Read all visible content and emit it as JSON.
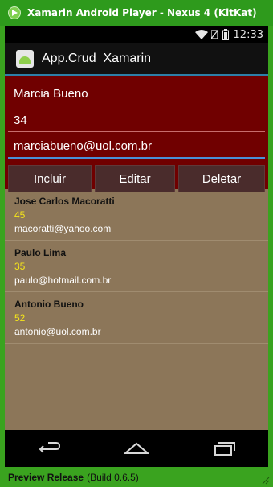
{
  "window": {
    "title": "Xamarin Android Player - Nexus 4 (KitKat)",
    "footer_bold": "Preview Release",
    "footer_text": "(Build 0.6.5)"
  },
  "status": {
    "time": "12:33"
  },
  "app": {
    "title": "App.Crud_Xamarin"
  },
  "form": {
    "name": "Marcia Bueno",
    "age": "34",
    "email": "marciabueno@uol.com.br"
  },
  "buttons": {
    "include": "Incluir",
    "edit": "Editar",
    "delete": "Deletar"
  },
  "list": [
    {
      "name": "Jose Carlos Macoratti",
      "age": "45",
      "email": "macoratti@yahoo.com"
    },
    {
      "name": "Paulo Lima",
      "age": "35",
      "email": "paulo@hotmail.com.br"
    },
    {
      "name": "Antonio Bueno",
      "age": "52",
      "email": "antonio@uol.com.br"
    }
  ],
  "colors": {
    "form_bg": "#700000",
    "list_bg": "#8c7659",
    "age_text": "#f5e51a",
    "frame_green": "#3aa31f"
  }
}
